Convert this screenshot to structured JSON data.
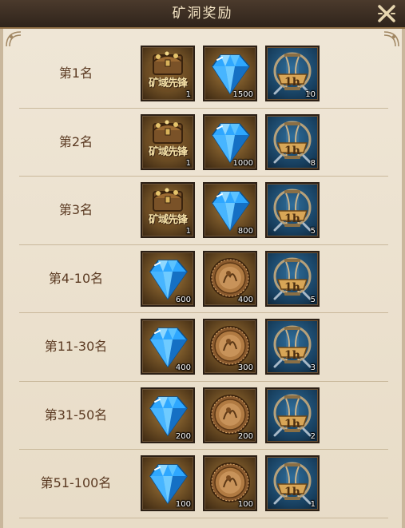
{
  "header": {
    "title": "矿洞奖励"
  },
  "icons": {
    "close": "close-x-icon",
    "chest": "treasure-chest-icon",
    "diamond": "diamond-icon",
    "coin": "bronze-coin-icon",
    "hourglass": "hourglass-speedup-icon"
  },
  "colors": {
    "header_bg": "#3a2d22",
    "panel_bg": "#ece3d2",
    "rank_text": "#5b3a22",
    "gold_frame": "#8b6b43"
  },
  "rows": [
    {
      "rank": "第1名",
      "items": [
        {
          "type": "chest",
          "badge": "矿域先锋",
          "count": "1"
        },
        {
          "type": "diamond",
          "count": "1500"
        },
        {
          "type": "hourglass",
          "label": "1h",
          "count": "10"
        }
      ]
    },
    {
      "rank": "第2名",
      "items": [
        {
          "type": "chest",
          "badge": "矿域先锋",
          "count": "1"
        },
        {
          "type": "diamond",
          "count": "1000"
        },
        {
          "type": "hourglass",
          "label": "1h",
          "count": "8"
        }
      ]
    },
    {
      "rank": "第3名",
      "items": [
        {
          "type": "chest",
          "badge": "矿域先锋",
          "count": "1"
        },
        {
          "type": "diamond",
          "count": "800"
        },
        {
          "type": "hourglass",
          "label": "1h",
          "count": "5"
        }
      ]
    },
    {
      "rank": "第4-10名",
      "items": [
        {
          "type": "diamond",
          "count": "600"
        },
        {
          "type": "coin",
          "count": "400"
        },
        {
          "type": "hourglass",
          "label": "1h",
          "count": "5"
        }
      ]
    },
    {
      "rank": "第11-30名",
      "items": [
        {
          "type": "diamond",
          "count": "400"
        },
        {
          "type": "coin",
          "count": "300"
        },
        {
          "type": "hourglass",
          "label": "1h",
          "count": "3"
        }
      ]
    },
    {
      "rank": "第31-50名",
      "items": [
        {
          "type": "diamond",
          "count": "200"
        },
        {
          "type": "coin",
          "count": "200"
        },
        {
          "type": "hourglass",
          "label": "1h",
          "count": "2"
        }
      ]
    },
    {
      "rank": "第51-100名",
      "items": [
        {
          "type": "diamond",
          "count": "100"
        },
        {
          "type": "coin",
          "count": "100"
        },
        {
          "type": "hourglass",
          "label": "1h",
          "count": "1"
        }
      ]
    }
  ]
}
